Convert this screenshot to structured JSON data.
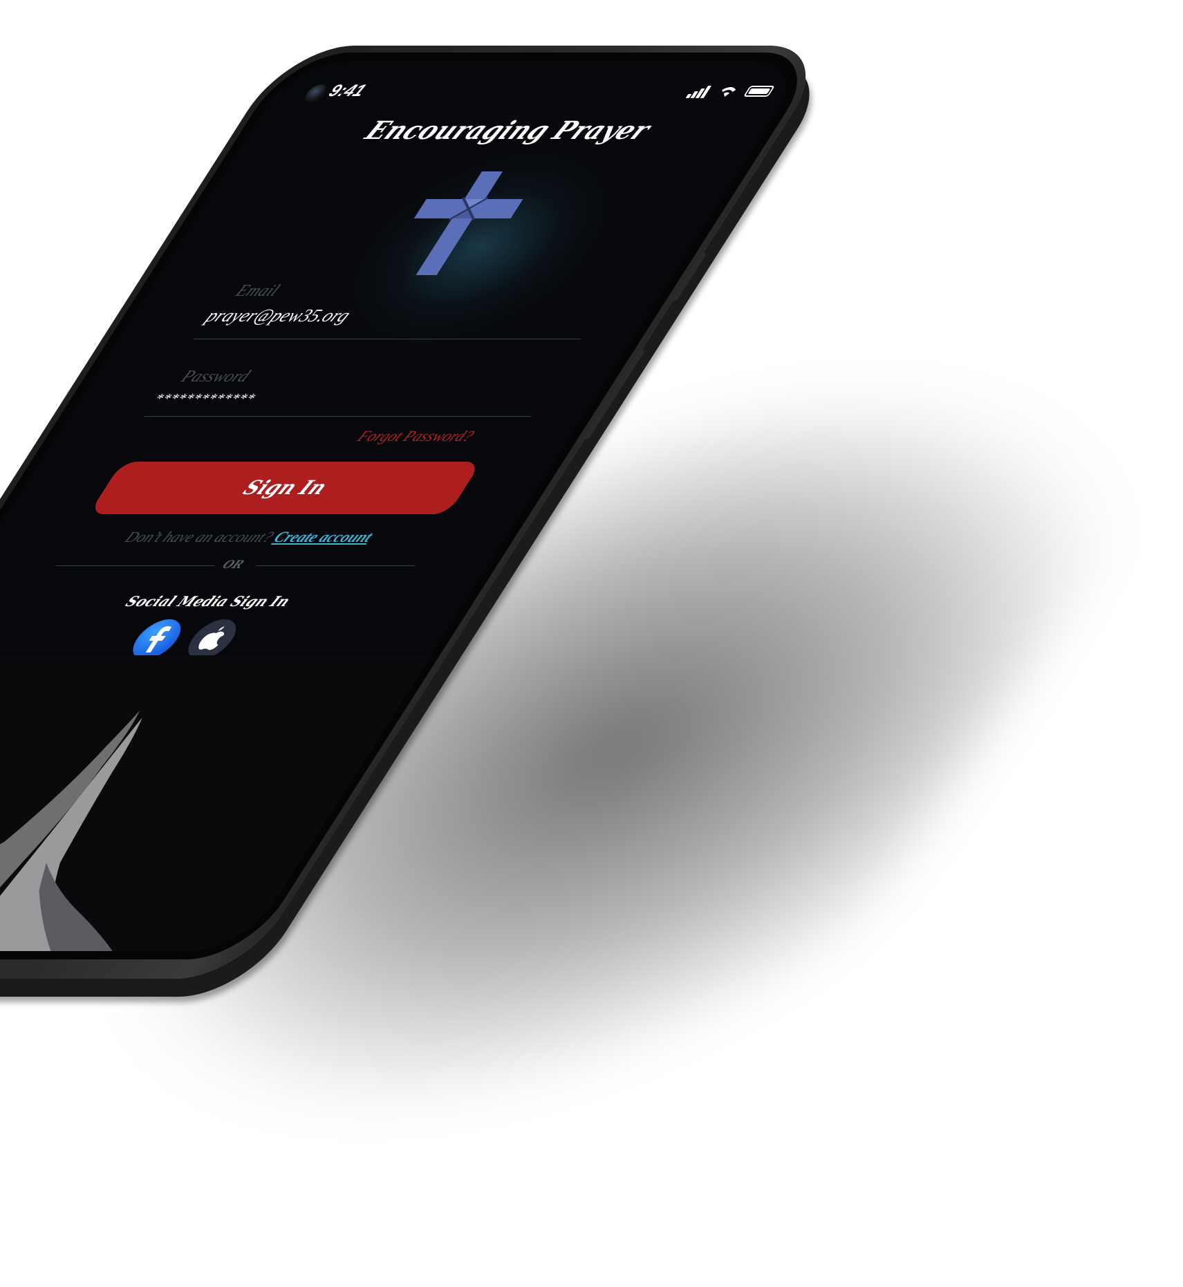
{
  "status_bar": {
    "time": "9:41"
  },
  "app": {
    "title": "Encouraging Prayer"
  },
  "login_form": {
    "email_label": "Email",
    "email_value": "prayer@pew35.org",
    "password_label": "Password",
    "password_value": "*************",
    "forgot_password": "Forgot Password?",
    "sign_in_label": "Sign In",
    "no_account_text": "Don’t have an account?",
    "create_account_link": "Create account",
    "or_divider": "OR"
  },
  "social": {
    "title": "Social Media Sign In",
    "providers": [
      "facebook-icon",
      "apple-icon"
    ]
  },
  "colors": {
    "background": "#07080b",
    "accent_red": "#ad1f1f",
    "link_cyan": "#3fb6d6",
    "cross_blue": "#5a6fb8"
  }
}
